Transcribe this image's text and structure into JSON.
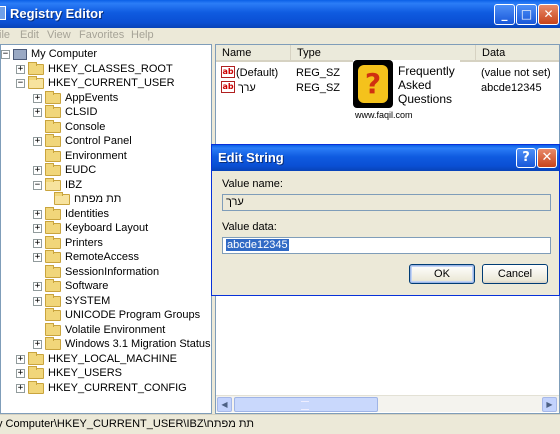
{
  "window": {
    "title": "Registry Editor",
    "controls": [
      "_",
      "□",
      "✕"
    ]
  },
  "menu": [
    "ile",
    "Edit",
    "View",
    "Favorites",
    "Help"
  ],
  "tree": {
    "root": "My Computer",
    "items": [
      {
        "label": "HKEY_CLASSES_ROOT",
        "expander": "+"
      },
      {
        "label": "HKEY_CURRENT_USER",
        "expander": "−"
      },
      {
        "label": "AppEvents",
        "expander": "+"
      },
      {
        "label": "CLSID",
        "expander": "+"
      },
      {
        "label": "Console",
        "expander": ""
      },
      {
        "label": "Control Panel",
        "expander": "+"
      },
      {
        "label": "Environment",
        "expander": ""
      },
      {
        "label": "EUDC",
        "expander": "+"
      },
      {
        "label": "IBZ",
        "expander": "−"
      },
      {
        "label": "תת מפתח",
        "expander": ""
      },
      {
        "label": "Identities",
        "expander": "+"
      },
      {
        "label": "Keyboard Layout",
        "expander": "+"
      },
      {
        "label": "Printers",
        "expander": "+"
      },
      {
        "label": "RemoteAccess",
        "expander": "+"
      },
      {
        "label": "SessionInformation",
        "expander": ""
      },
      {
        "label": "Software",
        "expander": "+"
      },
      {
        "label": "SYSTEM",
        "expander": "+"
      },
      {
        "label": "UNICODE Program Groups",
        "expander": ""
      },
      {
        "label": "Volatile Environment",
        "expander": ""
      },
      {
        "label": "Windows 3.1 Migration Status",
        "expander": "+"
      },
      {
        "label": "HKEY_LOCAL_MACHINE",
        "expander": "+"
      },
      {
        "label": "HKEY_USERS",
        "expander": "+"
      },
      {
        "label": "HKEY_CURRENT_CONFIG",
        "expander": "+"
      }
    ]
  },
  "list": {
    "columns": [
      "Name",
      "Type",
      "Data"
    ],
    "rows": [
      {
        "name": "(Default)",
        "type": "REG_SZ",
        "data": "(value not set)"
      },
      {
        "name": "ערך",
        "type": "REG_SZ",
        "data": "abcde12345"
      }
    ]
  },
  "watermark": {
    "glyph": "?",
    "lines": [
      "Frequently",
      "Asked",
      "Questions"
    ],
    "url": "www.faqil.com"
  },
  "status": "y Computer\\HKEY_CURRENT_USER\\IBZ\\תת מפתח",
  "dialog": {
    "title": "Edit String",
    "help": "?",
    "close": "✕",
    "value_name_label": "Value name:",
    "value_name": "ערך",
    "value_data_label": "Value data:",
    "value_data": "abcde12345",
    "ok": "OK",
    "cancel": "Cancel"
  },
  "scroll": {
    "left": "◀",
    "right": "▶"
  },
  "colors": {
    "titlebar": "#0a4fd4",
    "selection": "#316ac5",
    "close": "#c8431a"
  }
}
